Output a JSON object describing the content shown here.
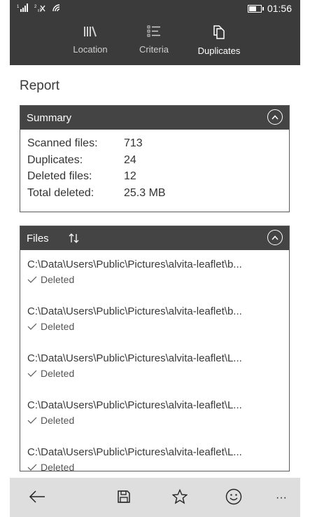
{
  "status": {
    "time": "01:56",
    "sim1": "1",
    "sim2": "2"
  },
  "nav": {
    "tabs": [
      {
        "label": "Location",
        "icon": "library-icon"
      },
      {
        "label": "Criteria",
        "icon": "list-icon"
      },
      {
        "label": "Duplicates",
        "icon": "duplicates-icon"
      }
    ]
  },
  "page": {
    "title": "Report"
  },
  "summary": {
    "header": "Summary",
    "rows": [
      {
        "label": "Scanned files:",
        "value": "713"
      },
      {
        "label": "Duplicates:",
        "value": "24"
      },
      {
        "label": "Deleted files:",
        "value": "12"
      },
      {
        "label": "Total deleted:",
        "value": "25.3 MB"
      }
    ]
  },
  "files": {
    "header": "Files",
    "items": [
      {
        "path": "C:\\Data\\Users\\Public\\Pictures\\alvita-leaflet\\b...",
        "status": "Deleted"
      },
      {
        "path": "C:\\Data\\Users\\Public\\Pictures\\alvita-leaflet\\b...",
        "status": "Deleted"
      },
      {
        "path": "C:\\Data\\Users\\Public\\Pictures\\alvita-leaflet\\L...",
        "status": "Deleted"
      },
      {
        "path": "C:\\Data\\Users\\Public\\Pictures\\alvita-leaflet\\L...",
        "status": "Deleted"
      },
      {
        "path": "C:\\Data\\Users\\Public\\Pictures\\alvita-leaflet\\L...",
        "status": "Deleted"
      }
    ]
  },
  "appbar": {
    "more": "···"
  },
  "colors": {
    "header": "#3b3b3b",
    "cardHeader": "#444444",
    "appbar": "#dedede"
  }
}
